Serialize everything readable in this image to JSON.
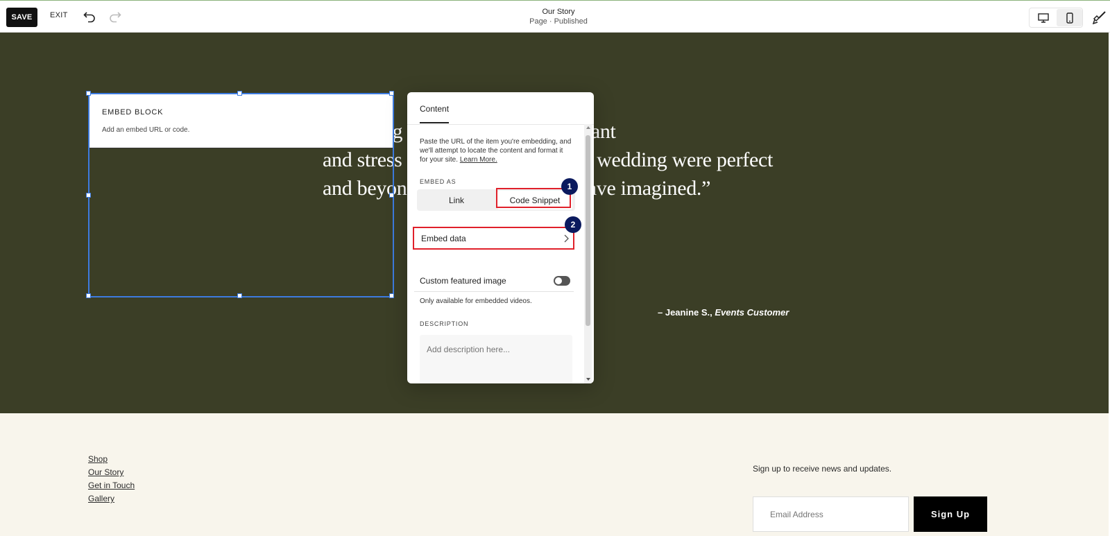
{
  "toolbar": {
    "save_label": "SAVE",
    "exit_label": "EXIT",
    "page_title": "Our Story",
    "page_status": "Page · Published"
  },
  "hero": {
    "quote_lines": [
      "“Working with Zulima was pleasant",
      "and stress free. The details of our wedding were perfect",
      "and beyond anything we could have imagined.”"
    ],
    "attribution_name": "– Jeanine S.,",
    "attribution_role": "Events Customer"
  },
  "embed_block": {
    "title": "EMBED BLOCK",
    "subtitle": "Add an embed URL or code."
  },
  "panel": {
    "tab_label": "Content",
    "intro_text": "Paste the URL of the item you're embedding, and we'll attempt to locate the content and format it for your site.",
    "learn_more": "Learn More.",
    "embed_as_label": "EMBED AS",
    "option_link": "Link",
    "option_code": "Code Snippet",
    "embed_data_label": "Embed data",
    "custom_image_label": "Custom featured image",
    "custom_image_note": "Only available for embedded videos.",
    "description_label": "DESCRIPTION",
    "description_placeholder": "Add description here...",
    "badge_1": "1",
    "badge_2": "2"
  },
  "footer": {
    "links": [
      "Shop",
      "Our Story",
      "Get in Touch",
      "Gallery"
    ],
    "signup_text": "Sign up to receive news and updates.",
    "email_placeholder": "Email Address",
    "signup_button": "Sign Up"
  },
  "colors": {
    "dark_section": "#3b3e26",
    "footer_bg": "#f8f5ec",
    "selection_blue": "#3d7be0",
    "highlight_red": "#e0202a",
    "badge_navy": "#0b1a5e"
  }
}
